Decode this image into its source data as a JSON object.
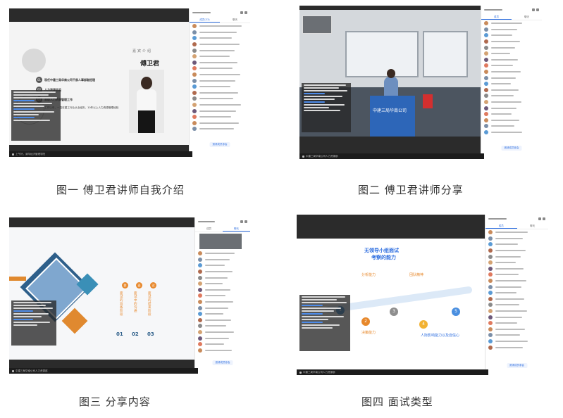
{
  "figures": [
    {
      "caption": "图一  傅卫君讲师自我介绍",
      "slide": {
        "title_small": "嘉宾介绍",
        "name": "傅卫君",
        "items": [
          {
            "num": "01",
            "text": "现任中建三局华南公司干部人事部副经理"
          },
          {
            "num": "02",
            "text": "人力资源总监"
          },
          {
            "num": "03",
            "text": "高级人力资源管理工作"
          }
        ],
        "detail": "工作以来，一直在建工行业从业经历，10年以上人力资源管理经验"
      },
      "side": {
        "tab1": "成员(33)",
        "tab2": "聊天",
        "button": "邀请成员参会"
      },
      "bar_text": "上午好，清华经济管理学院"
    },
    {
      "caption": "图二  傅卫君讲师分享",
      "banner": "中建三局华南公司",
      "side": {
        "tab1": "成员",
        "tab2": "聊天",
        "button": "邀请成员参会"
      },
      "bar_text": "中建三局华南公司人力资源部"
    },
    {
      "caption": "图三  分享内容",
      "slide": {
        "tags": [
          "群",
          "面",
          "试"
        ],
        "cols": [
          {
            "num": "01",
            "text": "面试的准备阶段"
          },
          {
            "num": "02",
            "text": "面试中的沟通"
          },
          {
            "num": "03",
            "text": "面试的结束阶段"
          }
        ]
      },
      "side": {
        "tab1": "成员",
        "tab2": "聊天",
        "button": "邀请成员参会"
      },
      "bar_text": "中建三局华南公司人力资源部"
    },
    {
      "caption": "图四  面试类型",
      "slide": {
        "title_line1": "无领导小组面试",
        "title_line2": "考察的能力",
        "steps": [
          {
            "num": "1",
            "label": "分析能力"
          },
          {
            "num": "2",
            "label": "决策能力"
          },
          {
            "num": "3",
            "label": "团队精神"
          },
          {
            "num": "4",
            "label": "人际影响能力以及自信心"
          },
          {
            "num": "5",
            "label": ""
          }
        ]
      },
      "side": {
        "tab1": "成员",
        "tab2": "聊天",
        "button": "邀请成员参会"
      },
      "bar_text": "中建三局华南公司人力资源部"
    }
  ],
  "colors": {
    "accent_blue": "#2f6fe0",
    "step_colors": [
      "#3c8fd3",
      "#e7882b",
      "#8e8e8e",
      "#f2b233",
      "#4a8fe0"
    ],
    "orange": "#e88a2f"
  }
}
